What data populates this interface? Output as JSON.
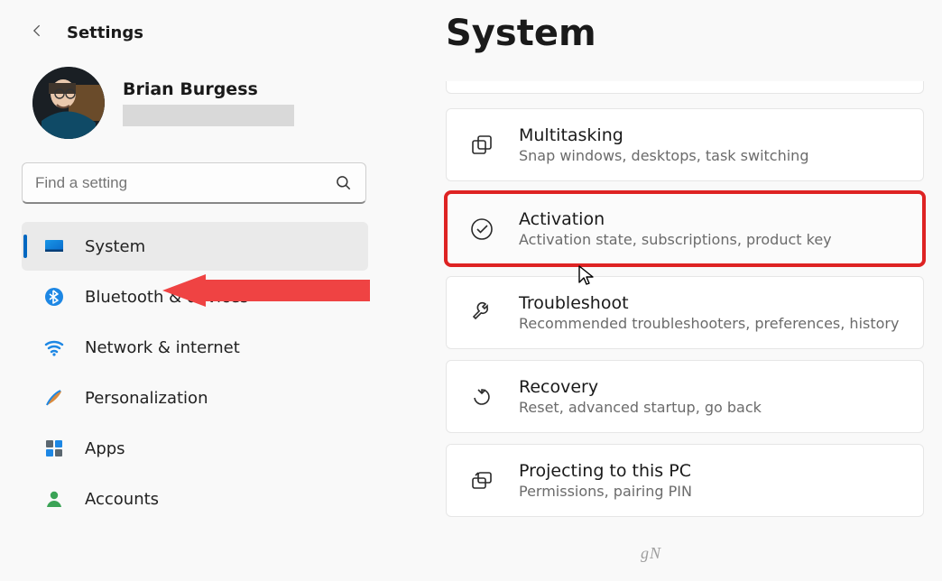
{
  "header": {
    "settings_label": "Settings"
  },
  "profile": {
    "name": "Brian Burgess"
  },
  "search": {
    "placeholder": "Find a setting"
  },
  "nav": {
    "items": [
      {
        "label": "System",
        "icon": "system-icon",
        "active": true
      },
      {
        "label": "Bluetooth & devices",
        "icon": "bluetooth-icon",
        "active": false
      },
      {
        "label": "Network & internet",
        "icon": "wifi-icon",
        "active": false
      },
      {
        "label": "Personalization",
        "icon": "brush-icon",
        "active": false
      },
      {
        "label": "Apps",
        "icon": "apps-icon",
        "active": false
      },
      {
        "label": "Accounts",
        "icon": "person-icon",
        "active": false
      }
    ]
  },
  "main": {
    "title": "System",
    "cards": [
      {
        "icon": "multitask-icon",
        "title": "Multitasking",
        "sub": "Snap windows, desktops, task switching",
        "highlighted": false
      },
      {
        "icon": "check-circle-icon",
        "title": "Activation",
        "sub": "Activation state, subscriptions, product key",
        "highlighted": true
      },
      {
        "icon": "wrench-icon",
        "title": "Troubleshoot",
        "sub": "Recommended troubleshooters, preferences, history",
        "highlighted": false
      },
      {
        "icon": "recovery-icon",
        "title": "Recovery",
        "sub": "Reset, advanced startup, go back",
        "highlighted": false
      },
      {
        "icon": "projecting-icon",
        "title": "Projecting to this PC",
        "sub": "Permissions, pairing PIN",
        "highlighted": false
      }
    ]
  },
  "watermark": "gN"
}
